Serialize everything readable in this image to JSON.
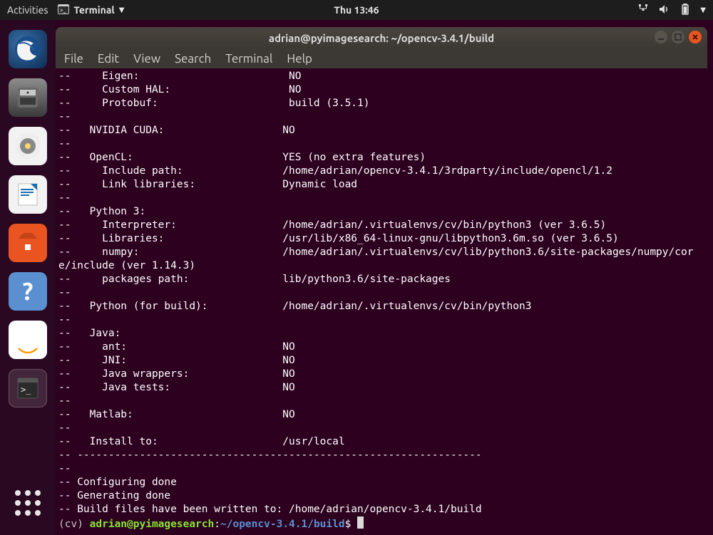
{
  "topbar": {
    "activities": "Activities",
    "app_name": "Terminal",
    "clock": "Thu 13:46"
  },
  "launcher": {
    "thunderbird": "✉",
    "files": "🗄",
    "rhythmbox": "◎",
    "writer": "▤",
    "software": "A",
    "help": "?",
    "amazon": "a",
    "terminal": ">_"
  },
  "window": {
    "title": "adrian@pyimagesearch: ~/opencv-3.4.1/build"
  },
  "menubar": {
    "file": "File",
    "edit": "Edit",
    "view": "View",
    "search": "Search",
    "terminal": "Terminal",
    "help": "Help"
  },
  "terminal": {
    "lines": [
      "--     Eigen:                        NO",
      "--     Custom HAL:                   NO",
      "--     Protobuf:                     build (3.5.1)",
      "-- ",
      "--   NVIDIA CUDA:                   NO",
      "-- ",
      "--   OpenCL:                        YES (no extra features)",
      "--     Include path:                /home/adrian/opencv-3.4.1/3rdparty/include/opencl/1.2",
      "--     Link libraries:              Dynamic load",
      "-- ",
      "--   Python 3:",
      "--     Interpreter:                 /home/adrian/.virtualenvs/cv/bin/python3 (ver 3.6.5)",
      "--     Libraries:                   /usr/lib/x86_64-linux-gnu/libpython3.6m.so (ver 3.6.5)",
      "--     numpy:                       /home/adrian/.virtualenvs/cv/lib/python3.6/site-packages/numpy/cor",
      "e/include (ver 1.14.3)",
      "--     packages path:               lib/python3.6/site-packages",
      "-- ",
      "--   Python (for build):            /home/adrian/.virtualenvs/cv/bin/python3",
      "-- ",
      "--   Java:",
      "--     ant:                         NO",
      "--     JNI:                         NO",
      "--     Java wrappers:               NO",
      "--     Java tests:                  NO",
      "-- ",
      "--   Matlab:                        NO",
      "-- ",
      "--   Install to:                    /usr/local",
      "-- -----------------------------------------------------------------",
      "-- ",
      "-- Configuring done",
      "-- Generating done",
      "-- Build files have been written to: /home/adrian/opencv-3.4.1/build"
    ],
    "prompt": {
      "venv": "(cv) ",
      "user": "adrian@pyimagesearch",
      "colon": ":",
      "path": "~/opencv-3.4.1/build",
      "dollar": "$ "
    }
  }
}
